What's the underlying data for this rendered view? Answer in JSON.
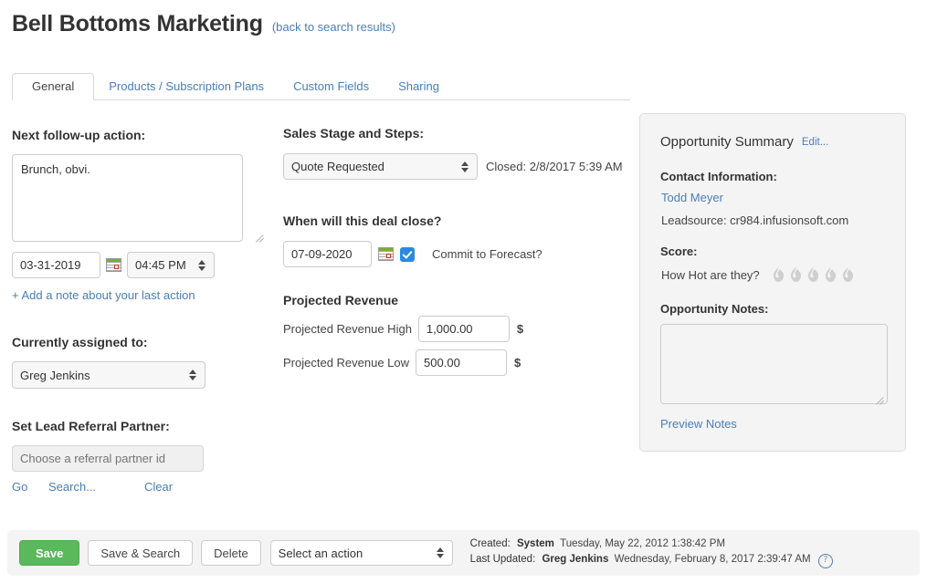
{
  "header": {
    "title": "Bell Bottoms Marketing",
    "back_link": "(back to search results)"
  },
  "tabs": [
    {
      "label": "General",
      "active": true
    },
    {
      "label": "Products / Subscription Plans",
      "active": false
    },
    {
      "label": "Custom Fields",
      "active": false
    },
    {
      "label": "Sharing",
      "active": false
    }
  ],
  "left_column": {
    "follow_up_label": "Next follow-up action:",
    "follow_up_text": "Brunch, obvi.",
    "follow_up_date": "03-31-2019",
    "follow_up_time": "04:45 PM",
    "calendar_icon": "calendar-icon",
    "add_note_link": "+ Add a note about your last action",
    "assigned_label": "Currently assigned to:",
    "assigned_value": "Greg Jenkins",
    "referral_label": "Set Lead Referral Partner:",
    "referral_placeholder": "Choose a referral partner id",
    "referral_value": "",
    "go_link": "Go",
    "search_link": "Search...",
    "clear_link": "Clear"
  },
  "middle_column": {
    "sales_stage_label": "Sales Stage and Steps:",
    "sales_stage_value": "Quote Requested",
    "closed_text": "Closed: 2/8/2017 5:39 AM",
    "deal_close_label": "When will this deal close?",
    "deal_close_date": "07-09-2020",
    "commit_label": "Commit to Forecast?",
    "commit_checked": true,
    "revenue_heading": "Projected Revenue",
    "revenue_high_label": "Projected Revenue High",
    "revenue_high_value": "1,000.00",
    "revenue_low_label": "Projected Revenue Low",
    "revenue_low_value": "500.00",
    "currency_symbol": "$"
  },
  "summary": {
    "title": "Opportunity Summary",
    "edit_link": "Edit...",
    "contact_heading": "Contact Information:",
    "contact_name": "Todd Meyer",
    "leadsource": "Leadsource: cr984.infusionsoft.com",
    "score_heading": "Score:",
    "score_question": "How Hot are they?",
    "score_flames_total": 5,
    "score_flames_filled": 0,
    "flame_color": "#cfcfcf",
    "notes_heading": "Opportunity Notes:",
    "notes_value": "",
    "preview_notes_link": "Preview Notes"
  },
  "bottom_bar": {
    "save_label": "Save",
    "save_search_label": "Save & Search",
    "delete_label": "Delete",
    "action_select_value": "Select an action",
    "created_label": "Created:",
    "created_actor": "System",
    "created_timestamp": "Tuesday, May 22, 2012 1:38:42 PM",
    "updated_label": "Last Updated:",
    "updated_actor": "Greg Jenkins",
    "updated_timestamp": "Wednesday, February 8, 2017 2:39:47 AM",
    "help_icon": "help-icon"
  },
  "colors": {
    "accent_link": "#4a7eb8",
    "save_green": "#5cb85c",
    "checkbox_blue": "#2b8ae0",
    "panel_bg": "#f4f4f4"
  }
}
